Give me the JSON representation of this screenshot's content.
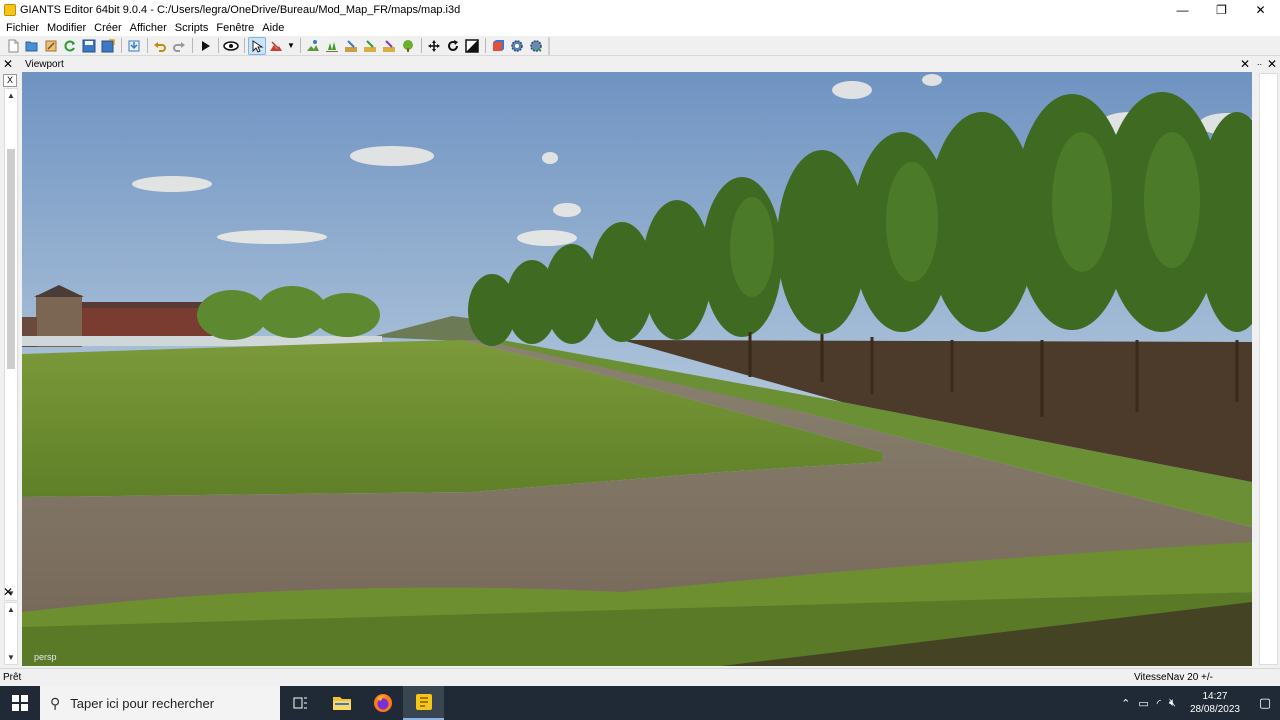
{
  "window": {
    "title": "GIANTS Editor 64bit 9.0.4 - C:/Users/legra/OneDrive/Bureau/Mod_Map_FR/maps/map.i3d",
    "controls": [
      "—",
      "❐",
      "✕"
    ]
  },
  "menu": [
    "Fichier",
    "Modifier",
    "Créer",
    "Afficher",
    "Scripts",
    "Fenêtre",
    "Aide"
  ],
  "toolbar": {
    "icons": [
      "new-file-icon",
      "open-folder-icon",
      "edit-icon",
      "refresh-icon",
      "save-icon",
      "save-as-icon",
      "import-icon",
      "undo-icon",
      "redo-icon",
      "play-icon",
      "eye-icon",
      "select-icon",
      "terrain-icon",
      "dropdown-icon",
      "paint-terrain-icon",
      "paint-foliage-icon",
      "paint-fields-icon",
      "paint-color-icon",
      "paint-info-icon",
      "tree-icon",
      "move-icon",
      "rotate-icon",
      "scale-icon",
      "cube-icon",
      "settings-gear-icon",
      "gear-refresh-icon"
    ]
  },
  "left_panel": {
    "close": "✕",
    "x_button": "X",
    "close2": "✕",
    "arrow_up": "▲",
    "arrow_down": "▼"
  },
  "viewport": {
    "title": "Viewport",
    "close": "✕",
    "camera_mode": "persp"
  },
  "right_panel": {
    "dots": "..",
    "close": "✕"
  },
  "status": {
    "left": "Prêt",
    "right": "VitesseNav 20 +/-"
  },
  "taskbar": {
    "search_placeholder": "Taper ici pour rechercher",
    "time": "14:27",
    "date": "28/08/2023"
  },
  "colors": {
    "taskbar_bg": "#1f2a36",
    "accent": "#cce4f7"
  }
}
